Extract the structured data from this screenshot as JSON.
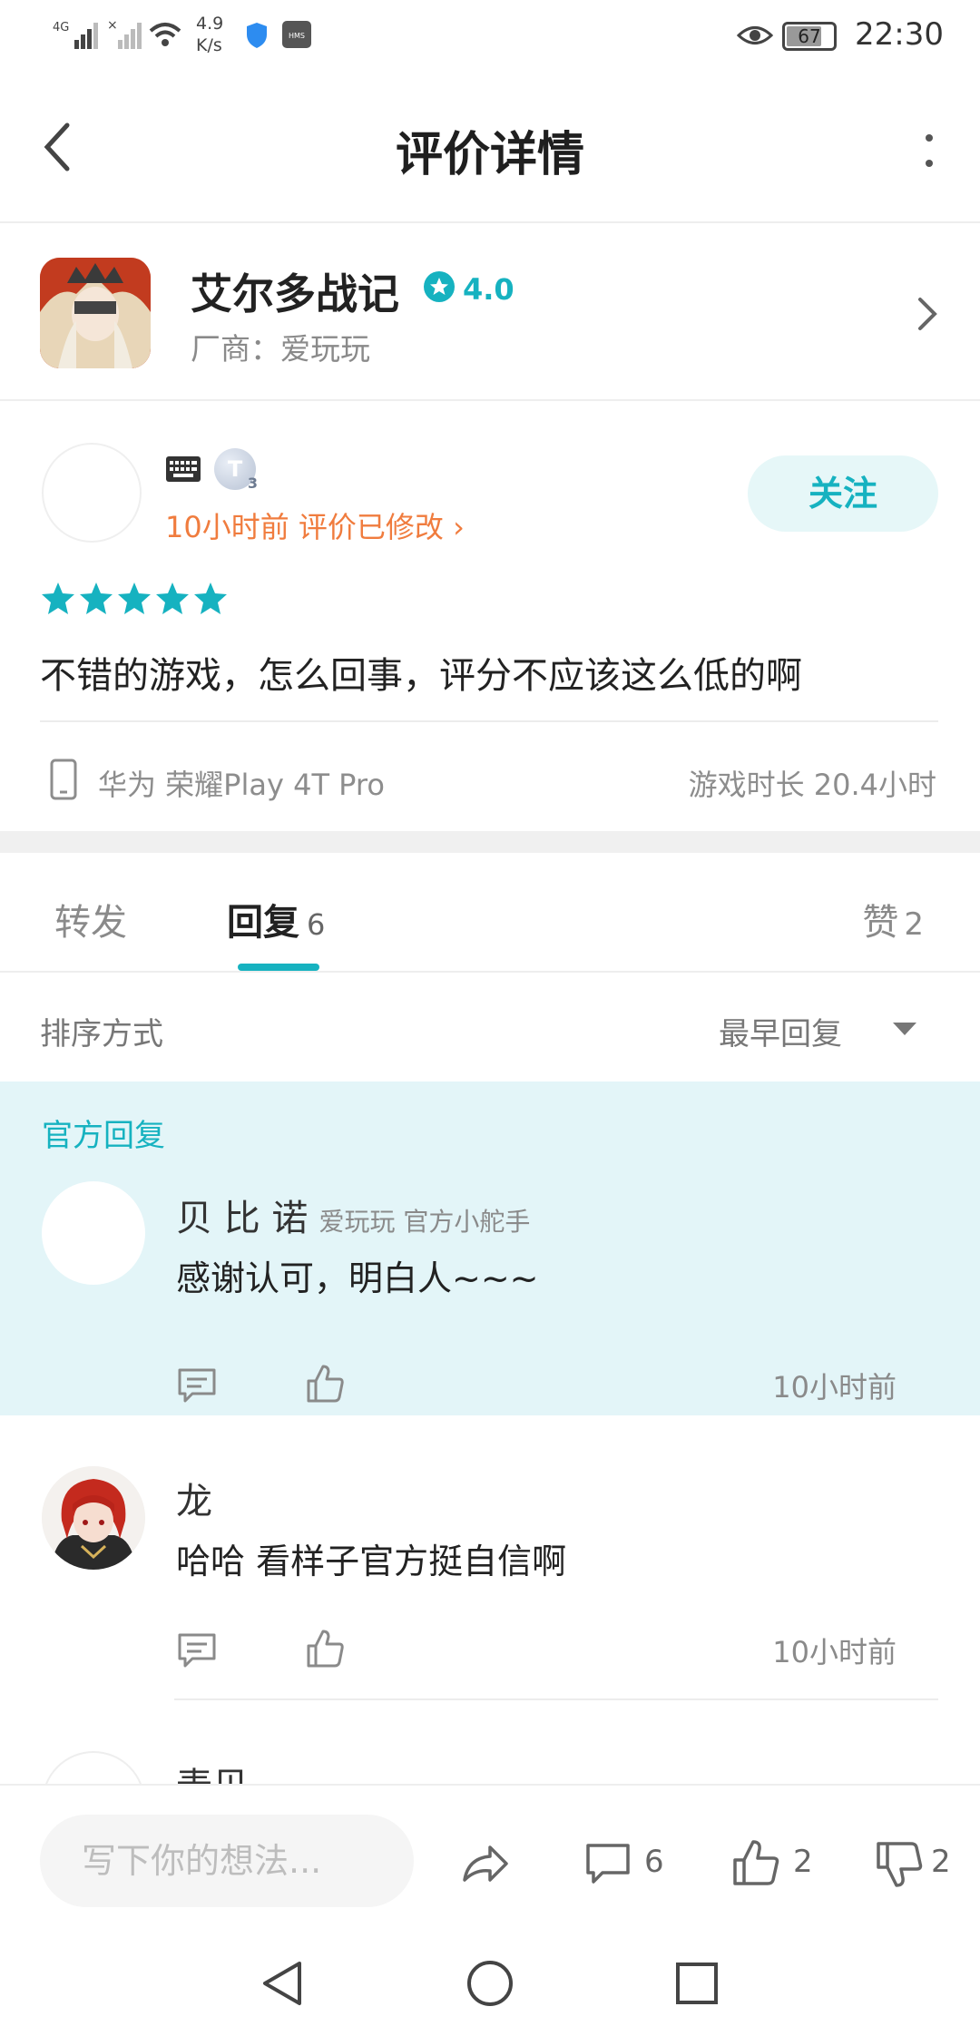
{
  "status_bar": {
    "network": "4G",
    "net_speed_value": "4.9",
    "net_speed_unit": "K/s",
    "hms_label": "HMS",
    "battery": "67",
    "time": "22:30"
  },
  "header": {
    "title": "评价详情"
  },
  "game": {
    "name": "艾尔多战记",
    "rating": "4.0",
    "vendor": "厂商：爱玩玩"
  },
  "review": {
    "badge": "T",
    "badge_level": "3",
    "meta": "10小时前 评价已修改 ›",
    "follow_label": "关注",
    "stars": 5,
    "text": "不错的游戏，怎么回事，评分不应该这么低的啊",
    "device": "华为 荣耀Play 4T Pro",
    "playtime": "游戏时长 20.4小时"
  },
  "tabs": {
    "forward": "转发",
    "reply": "回复",
    "reply_count": "6",
    "like": "赞",
    "like_count": "2"
  },
  "sort": {
    "label": "排序方式",
    "value": "最早回复"
  },
  "official_reply": {
    "section_label": "官方回复",
    "name": "贝 比 诺",
    "tag": "爱玩玩 官方小舵手",
    "text": "感谢认可，明白人~~~",
    "time": "10小时前"
  },
  "replies": [
    {
      "name": "龙",
      "text": "哈哈 看样子官方挺自信啊",
      "time": "10小时前"
    },
    {
      "name": "麦贝"
    }
  ],
  "bottom_bar": {
    "input_placeholder": "写下你的想法...",
    "comment_count": "6",
    "like_count": "2",
    "dislike_count": "2"
  },
  "colors": {
    "accent": "#16b2c0",
    "orange": "#f07c3e",
    "official_bg": "#e3f5f8"
  }
}
